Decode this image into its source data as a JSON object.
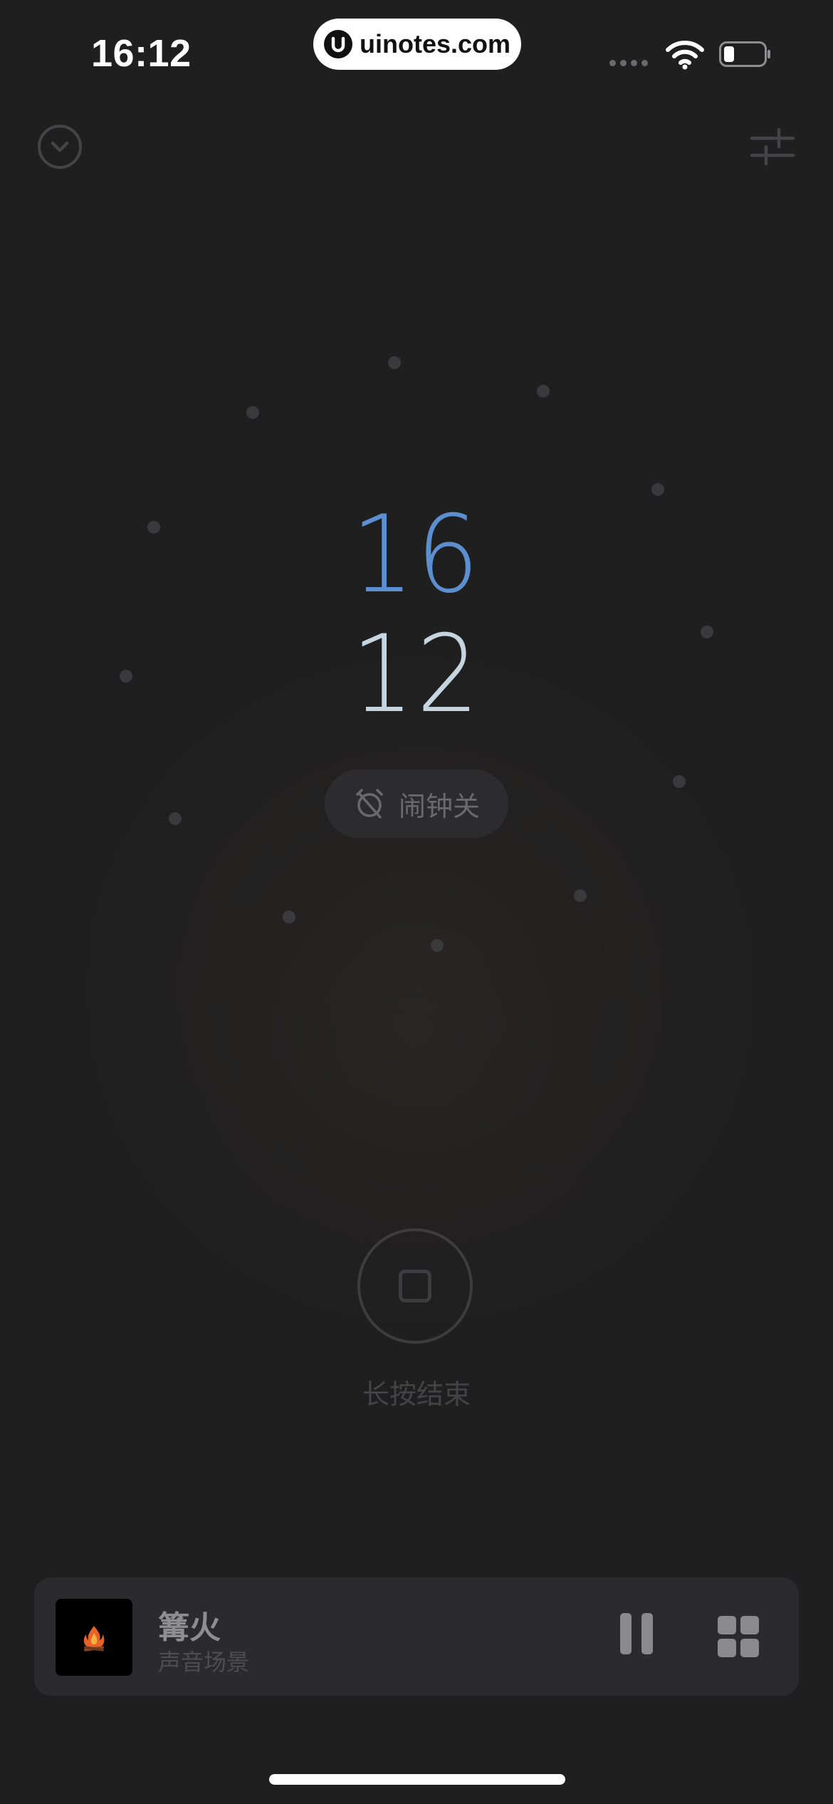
{
  "status_bar": {
    "time": "16:12",
    "site_label": "uinotes.com"
  },
  "top_bar": {
    "collapse_icon": "chevron-down-circle-icon",
    "settings_icon": "sliders-icon"
  },
  "clock": {
    "hour": "16",
    "minute": "12"
  },
  "alarm": {
    "label": "闹钟关",
    "icon": "alarm-off-icon"
  },
  "stop": {
    "label": "长按结束",
    "icon": "stop-icon"
  },
  "player": {
    "title": "篝火",
    "subtitle": "声音场景",
    "art_icon": "campfire-icon",
    "pause_icon": "pause-icon",
    "grid_icon": "grid-icon"
  },
  "colors": {
    "background": "#1f1f20",
    "hour": "#5b8fd0",
    "minute": "#c6d6e0",
    "chip": "#2c2c2e",
    "player": "#2b2b2d"
  }
}
